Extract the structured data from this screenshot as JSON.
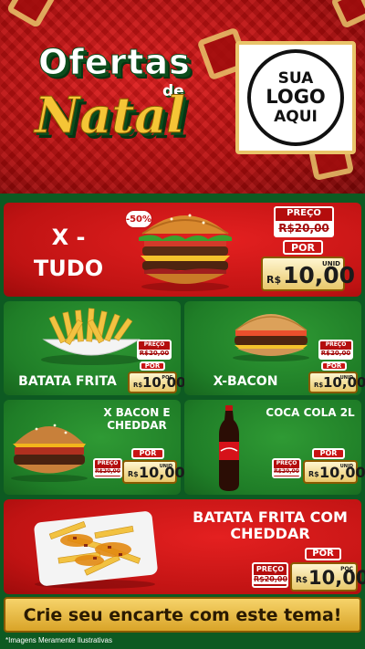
{
  "header": {
    "title_line1": "Ofertas",
    "title_de": "de",
    "title_line2": "Natal",
    "logo": [
      "SUA",
      "LOGO",
      "AQUI"
    ]
  },
  "featured": {
    "name_line1": "X -",
    "name_line2": "TUDO",
    "discount": "-50%",
    "preco_label": "PREÇO",
    "old_price": "R$20,00",
    "por_label": "POR",
    "currency": "R$",
    "price": "10,00",
    "unit": "UNID"
  },
  "products": [
    {
      "name": "BATATA FRITA",
      "preco_label": "PREÇO",
      "old_price": "R$20,00",
      "por_label": "POR",
      "currency": "R$",
      "price": "10,00",
      "unit": "POÇ"
    },
    {
      "name": "X-BACON",
      "preco_label": "PREÇO",
      "old_price": "R$20,00",
      "por_label": "POR",
      "currency": "R$",
      "price": "10,00",
      "unit": "UNID"
    },
    {
      "name": "X BACON E CHEDDAR",
      "preco_label": "PREÇO",
      "old_price": "R$20,00",
      "por_label": "POR",
      "currency": "R$",
      "price": "10,00",
      "unit": "UNID"
    },
    {
      "name": "COCA COLA 2L",
      "preco_label": "PREÇO",
      "old_price": "R$20,00",
      "por_label": "POR",
      "currency": "R$",
      "price": "10,00",
      "unit": "UNID"
    }
  ],
  "bottom_product": {
    "name": "BATATA FRITA COM CHEDDAR",
    "preco_label": "PREÇO",
    "old_price": "R$20,00",
    "por_label": "POR",
    "currency": "R$",
    "price": "10,00",
    "unit": "POÇ"
  },
  "banner_text": "Crie seu encarte com este tema!",
  "footnote": "*Imagens Meramente Ilustrativas",
  "colors": {
    "red": "#c01313",
    "green": "#1f7d27",
    "gold": "#e9c46a"
  }
}
